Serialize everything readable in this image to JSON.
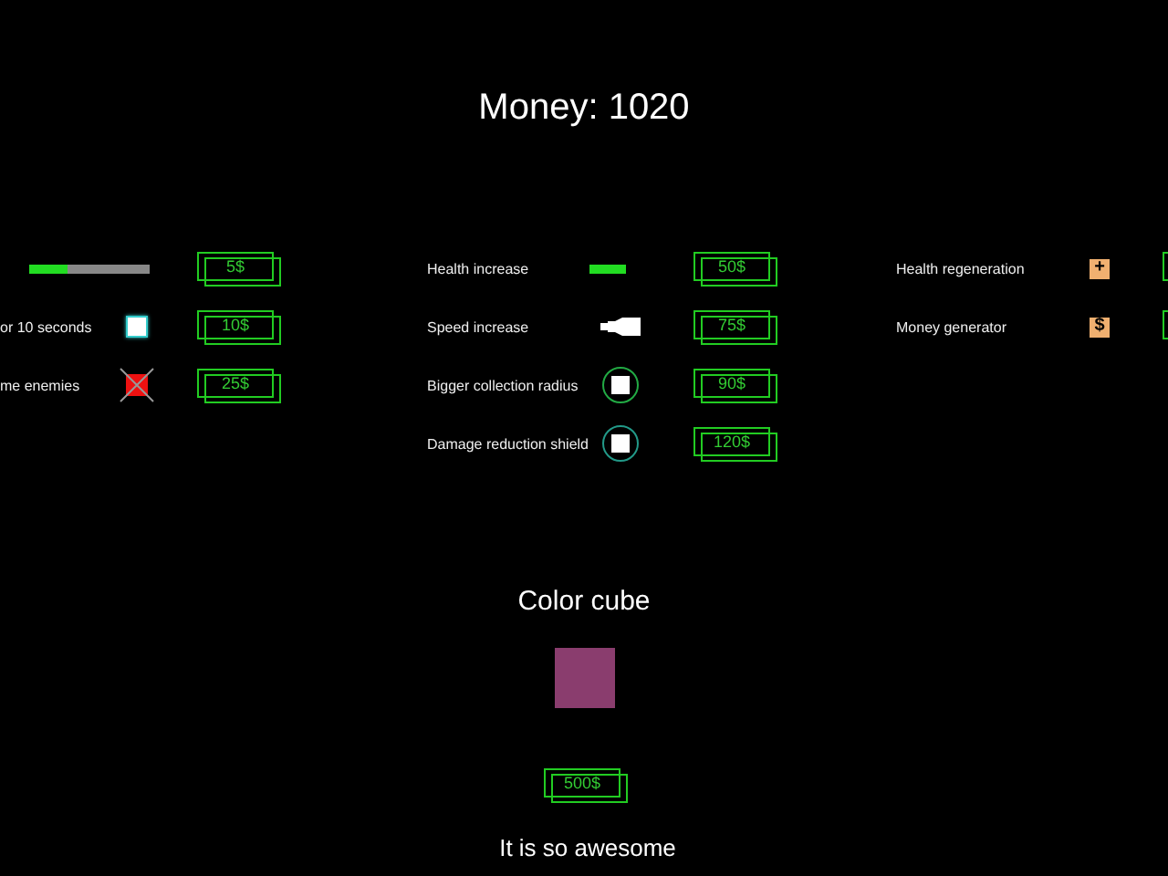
{
  "money": "Money: 1020",
  "columns": [
    {
      "items": [
        {
          "kind": "meter",
          "level": 0.32,
          "price": "5$"
        },
        {
          "kind": "frozen",
          "label": "or 10 seconds",
          "price": "10$"
        },
        {
          "kind": "cross",
          "label": "me enemies",
          "price": "25$"
        }
      ]
    },
    {
      "items": [
        {
          "kind": "health",
          "label": "Health increase",
          "price": "50$"
        },
        {
          "kind": "bullet",
          "label": "Speed increase",
          "price": "75$"
        },
        {
          "kind": "circle",
          "label": "Bigger collection radius",
          "color": "#22aa44",
          "price": "90$"
        },
        {
          "kind": "circle",
          "label": "Damage reduction shield",
          "color": "#229988",
          "price": "120$"
        }
      ]
    },
    {
      "items": [
        {
          "kind": "glyph",
          "label": "Health regeneration",
          "glyph": "+"
        },
        {
          "kind": "glyph",
          "label": "Money generator",
          "glyph": "$"
        }
      ]
    }
  ],
  "offer": {
    "title": "Color cube",
    "color": "#8a3d6e",
    "price": "500$",
    "caption": "It is so awesome"
  }
}
